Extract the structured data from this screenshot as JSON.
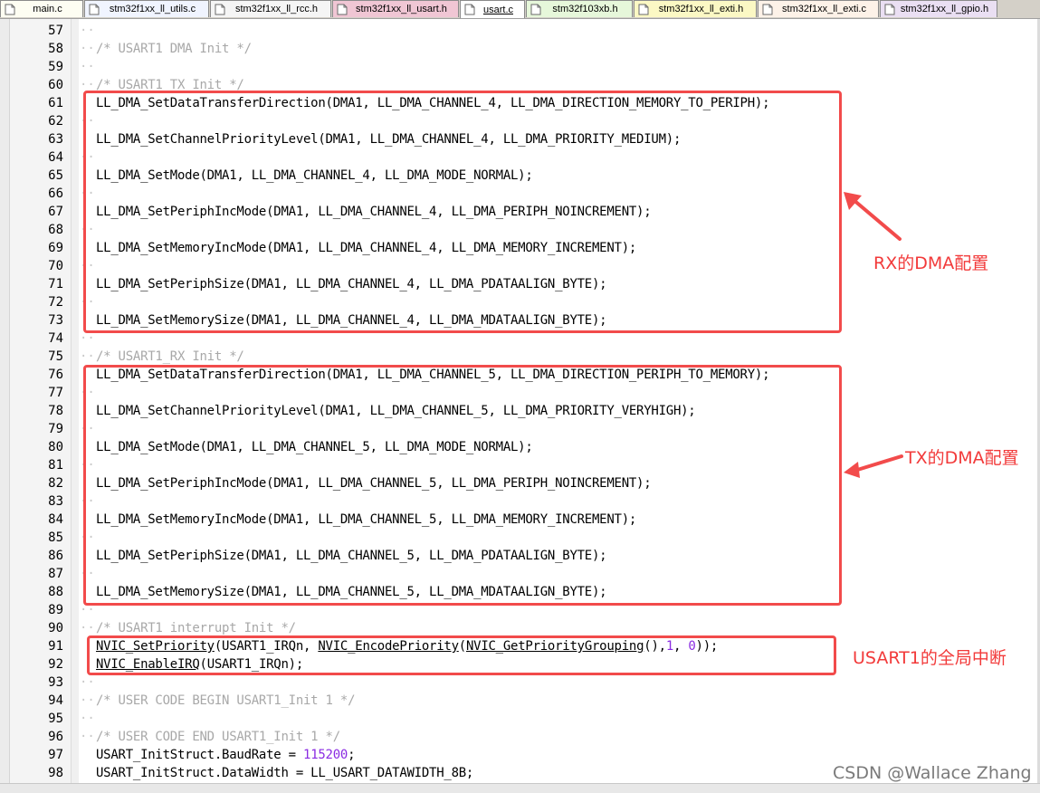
{
  "tabs": [
    {
      "label": "main.c",
      "bg": "#fdfdf2",
      "icon": "c-file-icon"
    },
    {
      "label": "stm32f1xx_ll_utils.c",
      "bg": "#f0f4ff",
      "icon": "c-file-icon"
    },
    {
      "label": "stm32f1xx_ll_rcc.h",
      "bg": "#f5f5f5",
      "icon": "h-file-icon"
    },
    {
      "label": "stm32f1xx_ll_usart.h",
      "bg": "#f0c6d4",
      "icon": "h-file-icon"
    },
    {
      "label": "usart.c",
      "bg": "#ffffff",
      "icon": "c-file-icon",
      "active": true
    },
    {
      "label": "stm32f103xb.h",
      "bg": "#e6f7da",
      "icon": "h-file-icon"
    },
    {
      "label": "stm32f1xx_ll_exti.h",
      "bg": "#fbf8c4",
      "icon": "h-file-icon"
    },
    {
      "label": "stm32f1xx_ll_exti.c",
      "bg": "#fdf2e8",
      "icon": "c-file-icon"
    },
    {
      "label": "stm32f1xx_ll_gpio.h",
      "bg": "#eadff3",
      "icon": "h-file-icon"
    }
  ],
  "lines": [
    {
      "n": "57",
      "t": ""
    },
    {
      "n": "58",
      "t": "/* USART1 DMA Init */",
      "k": "comment"
    },
    {
      "n": "59",
      "t": ""
    },
    {
      "n": "60",
      "t": "/* USART1_TX Init */",
      "k": "comment"
    },
    {
      "n": "61",
      "t": "LL_DMA_SetDataTransferDirection(DMA1, LL_DMA_CHANNEL_4, LL_DMA_DIRECTION_MEMORY_TO_PERIPH);"
    },
    {
      "n": "62",
      "t": ""
    },
    {
      "n": "63",
      "t": "LL_DMA_SetChannelPriorityLevel(DMA1, LL_DMA_CHANNEL_4, LL_DMA_PRIORITY_MEDIUM);"
    },
    {
      "n": "64",
      "t": ""
    },
    {
      "n": "65",
      "t": "LL_DMA_SetMode(DMA1, LL_DMA_CHANNEL_4, LL_DMA_MODE_NORMAL);"
    },
    {
      "n": "66",
      "t": ""
    },
    {
      "n": "67",
      "t": "LL_DMA_SetPeriphIncMode(DMA1, LL_DMA_CHANNEL_4, LL_DMA_PERIPH_NOINCREMENT);"
    },
    {
      "n": "68",
      "t": ""
    },
    {
      "n": "69",
      "t": "LL_DMA_SetMemoryIncMode(DMA1, LL_DMA_CHANNEL_4, LL_DMA_MEMORY_INCREMENT);"
    },
    {
      "n": "70",
      "t": ""
    },
    {
      "n": "71",
      "t": "LL_DMA_SetPeriphSize(DMA1, LL_DMA_CHANNEL_4, LL_DMA_PDATAALIGN_BYTE);"
    },
    {
      "n": "72",
      "t": ""
    },
    {
      "n": "73",
      "t": "LL_DMA_SetMemorySize(DMA1, LL_DMA_CHANNEL_4, LL_DMA_MDATAALIGN_BYTE);"
    },
    {
      "n": "74",
      "t": ""
    },
    {
      "n": "75",
      "t": "/* USART1_RX Init */",
      "k": "comment"
    },
    {
      "n": "76",
      "t": "LL_DMA_SetDataTransferDirection(DMA1, LL_DMA_CHANNEL_5, LL_DMA_DIRECTION_PERIPH_TO_MEMORY);"
    },
    {
      "n": "77",
      "t": ""
    },
    {
      "n": "78",
      "t": "LL_DMA_SetChannelPriorityLevel(DMA1, LL_DMA_CHANNEL_5, LL_DMA_PRIORITY_VERYHIGH);"
    },
    {
      "n": "79",
      "t": ""
    },
    {
      "n": "80",
      "t": "LL_DMA_SetMode(DMA1, LL_DMA_CHANNEL_5, LL_DMA_MODE_NORMAL);"
    },
    {
      "n": "81",
      "t": ""
    },
    {
      "n": "82",
      "t": "LL_DMA_SetPeriphIncMode(DMA1, LL_DMA_CHANNEL_5, LL_DMA_PERIPH_NOINCREMENT);"
    },
    {
      "n": "83",
      "t": ""
    },
    {
      "n": "84",
      "t": "LL_DMA_SetMemoryIncMode(DMA1, LL_DMA_CHANNEL_5, LL_DMA_MEMORY_INCREMENT);"
    },
    {
      "n": "85",
      "t": ""
    },
    {
      "n": "86",
      "t": "LL_DMA_SetPeriphSize(DMA1, LL_DMA_CHANNEL_5, LL_DMA_PDATAALIGN_BYTE);"
    },
    {
      "n": "87",
      "t": ""
    },
    {
      "n": "88",
      "t": "LL_DMA_SetMemorySize(DMA1, LL_DMA_CHANNEL_5, LL_DMA_MDATAALIGN_BYTE);"
    },
    {
      "n": "89",
      "t": ""
    },
    {
      "n": "90",
      "t": "/* USART1 interrupt Init */",
      "k": "comment"
    },
    {
      "n": "91",
      "t": "NVIC_SetPriority(USART1_IRQn, NVIC_EncodePriority(NVIC_GetPriorityGrouping(),1, 0));",
      "k": "nvic1"
    },
    {
      "n": "92",
      "t": "NVIC_EnableIRQ(USART1_IRQn);",
      "k": "nvic2"
    },
    {
      "n": "93",
      "t": ""
    },
    {
      "n": "94",
      "t": "/* USER CODE BEGIN USART1_Init 1 */",
      "k": "comment"
    },
    {
      "n": "95",
      "t": ""
    },
    {
      "n": "96",
      "t": "/* USER CODE END USART1_Init 1 */",
      "k": "comment"
    },
    {
      "n": "97",
      "t": "USART_InitStruct.BaudRate = 115200;",
      "k": "baud"
    },
    {
      "n": "98",
      "t": "USART_InitStruct.DataWidth = LL_USART_DATAWIDTH_8B;"
    }
  ],
  "annotations": {
    "rx_label": "RX的DMA配置",
    "tx_label": "TX的DMA配置",
    "irq_label": "USART1的全局中断"
  },
  "watermark": "CSDN @Wallace Zhang",
  "colors": {
    "annotation": "#f24b4b",
    "comment": "#a8a8a8",
    "number": "#8a2be2"
  }
}
